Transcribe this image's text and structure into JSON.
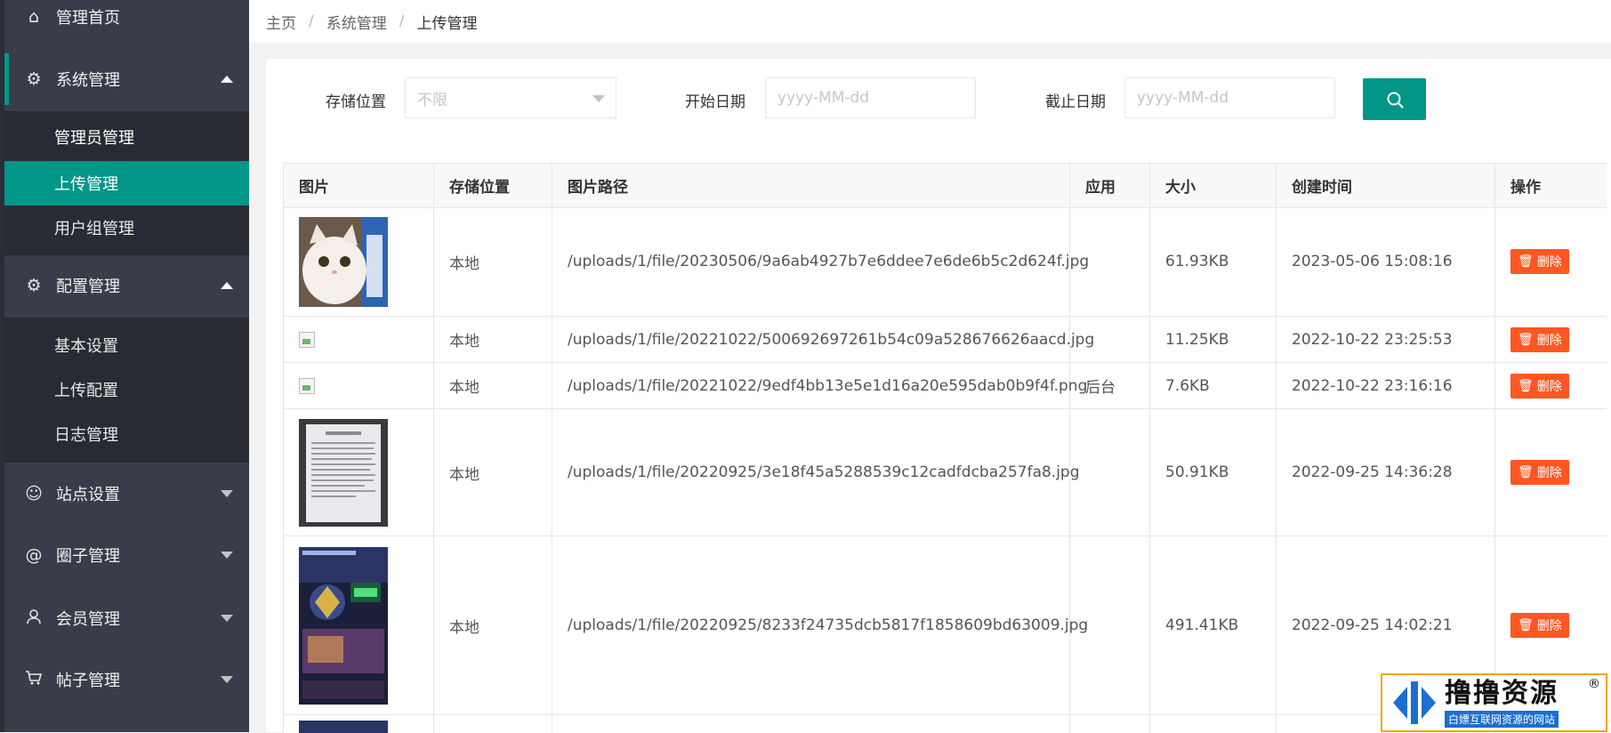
{
  "sidebar": {
    "home": {
      "label": "管理首页",
      "icon": "home-icon"
    },
    "system": {
      "label": "系统管理",
      "icon": "gear-icon",
      "items": [
        {
          "label": "管理员管理"
        },
        {
          "label": "上传管理"
        },
        {
          "label": "用户组管理"
        }
      ]
    },
    "config": {
      "label": "配置管理",
      "icon": "gear-icon",
      "items": [
        {
          "label": "基本设置"
        },
        {
          "label": "上传配置"
        },
        {
          "label": "日志管理"
        }
      ]
    },
    "site": {
      "label": "站点设置",
      "icon": "face-icon"
    },
    "circle": {
      "label": "圈子管理",
      "icon": "at-icon"
    },
    "member": {
      "label": "会员管理",
      "icon": "user-icon"
    },
    "posts": {
      "label": "帖子管理",
      "icon": "cart-icon"
    }
  },
  "breadcrumb": [
    "主页",
    "系统管理",
    "上传管理"
  ],
  "filters": {
    "storage_label": "存储位置",
    "storage_value": "不限",
    "start_label": "开始日期",
    "start_placeholder": "yyyy-MM-dd",
    "end_label": "截止日期",
    "end_placeholder": "yyyy-MM-dd"
  },
  "table": {
    "headers": [
      "图片",
      "存储位置",
      "图片路径",
      "应用",
      "大小",
      "创建时间",
      "操作"
    ],
    "rows": [
      {
        "storage": "本地",
        "path": "/uploads/1/file/20230506/9a6ab4927b7e6ddee7e6de6b5c2d624f.jpg",
        "app": "",
        "size": "61.93KB",
        "created": "2023-05-06 15:08:16",
        "action": "删除",
        "image": "cat-photo"
      },
      {
        "storage": "本地",
        "path": "/uploads/1/file/20221022/500692697261b54c09a528676626aacd.jpg",
        "app": "",
        "size": "11.25KB",
        "created": "2022-10-22 23:25:53",
        "action": "删除",
        "image": "broken-image"
      },
      {
        "storage": "本地",
        "path": "/uploads/1/file/20221022/9edf4bb13e5e1d16a20e595dab0b9f4f.png",
        "app": "后台",
        "size": "7.6KB",
        "created": "2022-10-22 23:16:16",
        "action": "删除",
        "image": "broken-image"
      },
      {
        "storage": "本地",
        "path": "/uploads/1/file/20220925/3e18f45a5288539c12cadfdcba257fa8.jpg",
        "app": "",
        "size": "50.91KB",
        "created": "2022-09-25 14:36:28",
        "action": "删除",
        "image": "notice-photo"
      },
      {
        "storage": "本地",
        "path": "/uploads/1/file/20220925/8233f24735dcb5817f1858609bd63009.jpg",
        "app": "",
        "size": "491.41KB",
        "created": "2022-09-25 14:02:21",
        "action": "删除",
        "image": "game-screen-photo"
      }
    ]
  },
  "watermark": {
    "title": "撸撸资源",
    "subtitle": "白嫖互联网资源的网站",
    "reg": "®"
  },
  "colors": {
    "sidebar": "#393d49",
    "accent": "#009688",
    "danger": "#ff5722"
  }
}
